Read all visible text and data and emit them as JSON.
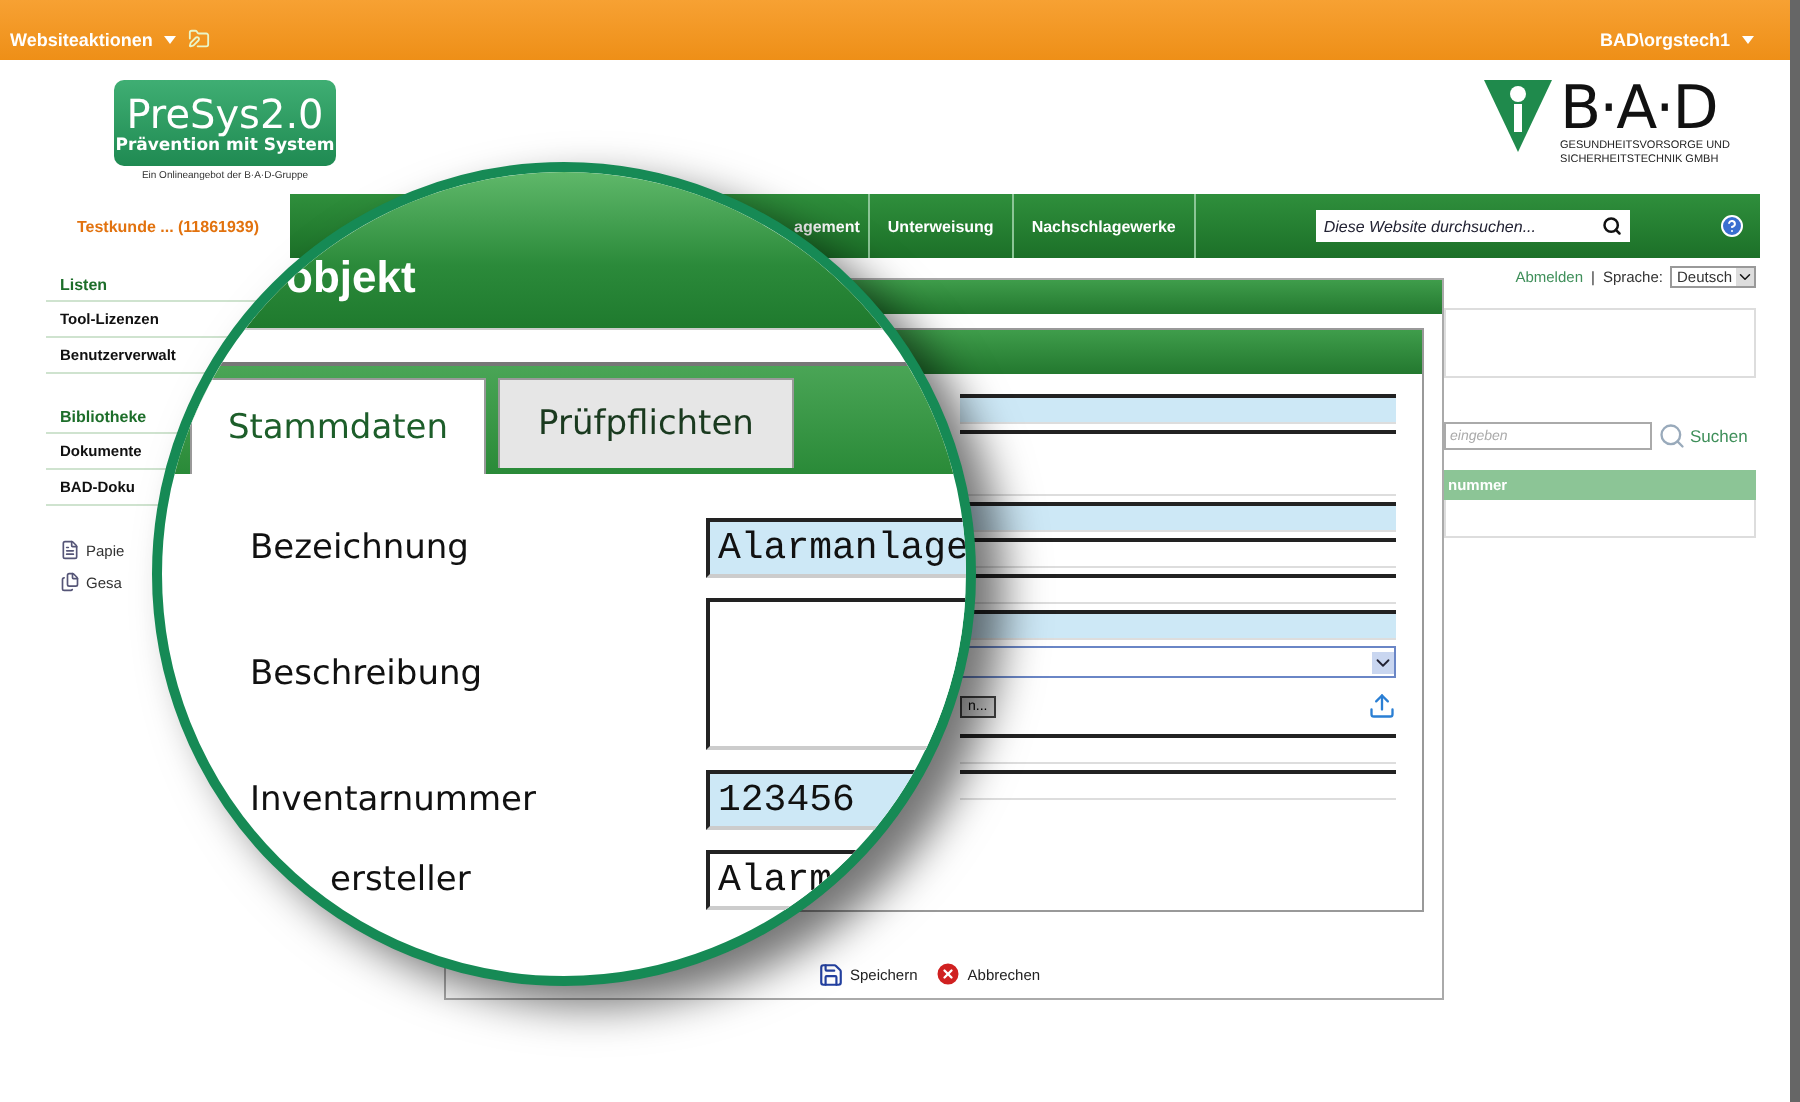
{
  "top_bar": {
    "site_actions": "Websiteaktionen",
    "user": "BAD\\orgstech1"
  },
  "logo": {
    "title": "PreSys2.0",
    "subtitle": "Prävention mit System",
    "tagline": "Ein Onlineangebot der B·A·D-Gruppe"
  },
  "brand": {
    "name": "B·A·D",
    "line1": "GESUNDHEITSVORSORGE UND",
    "line2": "SICHERHEITSTECHNIK GMBH"
  },
  "customer": "Testkunde ... (11861939)",
  "nav": {
    "items": [
      {
        "label": "agement"
      },
      {
        "label": "Unterweisung"
      },
      {
        "label": "Nachschlagewerke"
      }
    ],
    "search_placeholder": "Diese Website durchsuchen..."
  },
  "sidebar": {
    "sections": [
      {
        "heading": "Listen",
        "items": [
          "Tool-Lizenzen",
          "Benutzerverwalt"
        ]
      },
      {
        "heading": "Bibliotheke",
        "items": [
          "Dokumente",
          "BAD-Doku"
        ]
      }
    ],
    "links": [
      "Papie",
      "Gesa"
    ]
  },
  "account": {
    "logout": "Abmelden",
    "separator": "|",
    "language_label": "Sprache:",
    "language": "Deutsch"
  },
  "list_search": {
    "placeholder": "eingeben",
    "button": "Suchen"
  },
  "list_table": {
    "columns": [
      "nummer"
    ]
  },
  "dialog": {
    "fields": [
      {
        "kind": "text",
        "highlighted": true
      },
      {
        "kind": "textarea",
        "highlighted": false
      },
      {
        "kind": "text",
        "highlighted": true
      },
      {
        "kind": "text",
        "highlighted": false
      },
      {
        "kind": "text",
        "highlighted": false
      },
      {
        "kind": "text",
        "highlighted": true
      },
      {
        "kind": "select",
        "highlighted": false
      },
      {
        "kind": "file",
        "button": "n..."
      },
      {
        "kind": "text",
        "highlighted": false
      },
      {
        "kind": "text",
        "highlighted": false
      }
    ],
    "buttons": [
      {
        "kind": "save",
        "label": "Speichern"
      },
      {
        "kind": "cancel",
        "label": "Abbrechen"
      }
    ]
  },
  "magnifier": {
    "title": "objekt",
    "tabs": [
      {
        "label": "Stammdaten",
        "selected": true
      },
      {
        "label": "Prüfpflichten",
        "selected": false
      }
    ],
    "fields": [
      {
        "label": "Bezeichnung",
        "kind": "text",
        "value": "Alarmanlage",
        "highlighted": true
      },
      {
        "label": "Beschreibung",
        "kind": "textarea",
        "highlighted": false
      },
      {
        "label": "Inventarnummer",
        "kind": "text",
        "value": "123456",
        "highlighted": true
      },
      {
        "label": "ersteller",
        "kind": "text",
        "value": "Alarm",
        "highlighted": false
      }
    ]
  }
}
